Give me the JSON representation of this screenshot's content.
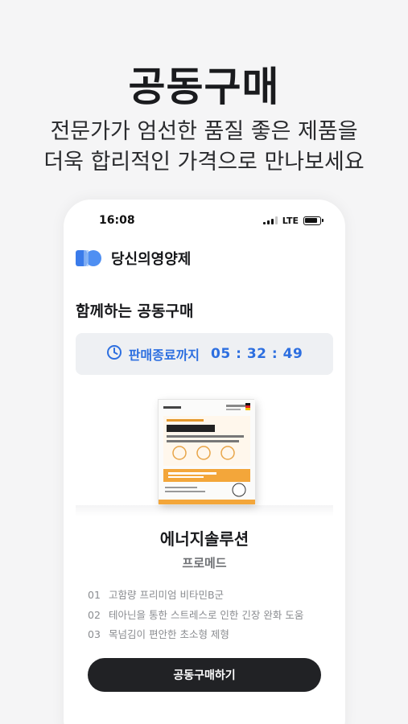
{
  "hero": {
    "title": "공동구매",
    "subtitle_line1": "전문가가 엄선한 품질 좋은 제품을",
    "subtitle_line2": "더욱 합리적인 가격으로 만나보세요"
  },
  "status_bar": {
    "time": "16:08",
    "network": "LTE"
  },
  "brand": {
    "name": "당신의영양제"
  },
  "group_buy": {
    "section_title": "함께하는 공동구매",
    "timer_label": "판매종료까지",
    "timer_value": "05 : 32 : 49"
  },
  "product": {
    "name": "에너지솔루션",
    "brand": "프로메드",
    "features": [
      {
        "num": "01",
        "text": "고함량 프리미엄 비타민B군"
      },
      {
        "num": "02",
        "text": "테아닌을 통한 스트레스로 인한 긴장 완화 도움"
      },
      {
        "num": "03",
        "text": "목넘김이 편안한 초소형 제형"
      }
    ]
  },
  "cta": {
    "label": "공동구매하기"
  },
  "colors": {
    "accent_blue": "#2d6fe0",
    "button_dark": "#212225",
    "page_bg": "#f5f5f6"
  }
}
